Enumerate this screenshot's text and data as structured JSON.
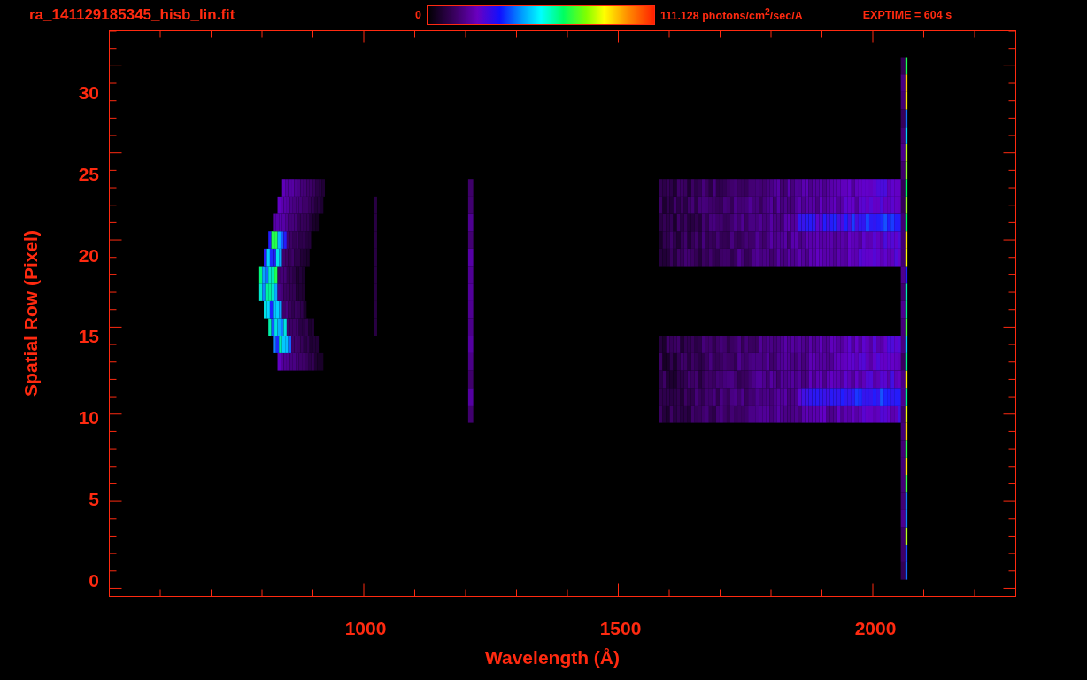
{
  "header": {
    "file_name": "ra_141129185345_hisb_lin.fit",
    "colorbar_min": "0",
    "colorbar_max": "111.128 photons/cm$^{2}$/sec/A",
    "exposure": "EXPTIME = 604 s"
  },
  "y_axis": {
    "title": "Spatial Row (Pixel)",
    "tick_labels": [
      "30",
      "25",
      "20",
      "15",
      "10",
      "5",
      "0"
    ]
  },
  "x_axis": {
    "title": "Wavelength (Å)",
    "tick_labels": [
      "1000",
      "1500",
      "2000"
    ]
  }
}
